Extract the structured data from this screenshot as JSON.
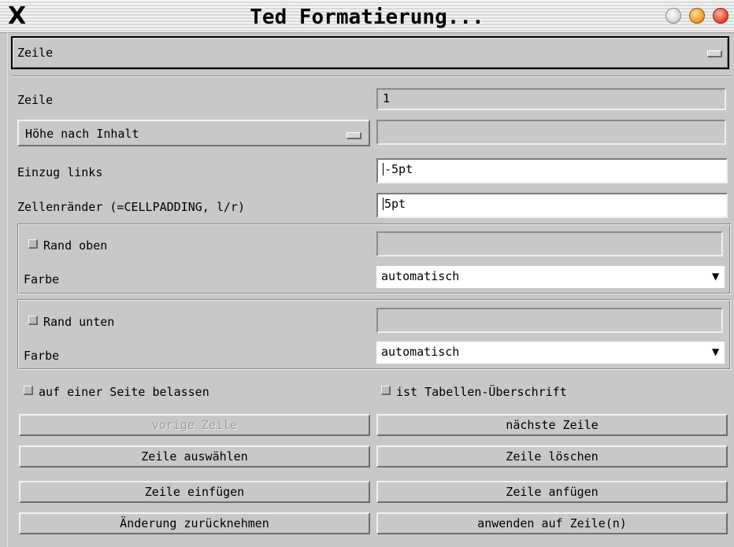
{
  "window": {
    "title": "Ted Formatierung...",
    "close_glyph": "X"
  },
  "section_selector": {
    "value": "Zeile"
  },
  "row": {
    "label": "Zeile",
    "value": "1"
  },
  "height": {
    "mode": "Höhe nach Inhalt",
    "value": ""
  },
  "indent_left": {
    "label": "Einzug links",
    "value": "-5pt"
  },
  "cell_padding": {
    "label": "Zellenränder (=CELLPADDING, l/r)",
    "value": "5pt"
  },
  "border_top": {
    "checkbox_label": "Rand oben",
    "checked": false,
    "width_value": "",
    "color_label": "Farbe",
    "color_value": "automatisch",
    "dropdown_glyph": "▼"
  },
  "border_bottom": {
    "checkbox_label": "Rand unten",
    "checked": false,
    "width_value": "",
    "color_label": "Farbe",
    "color_value": "automatisch",
    "dropdown_glyph": "▼"
  },
  "options": {
    "keep_on_page": {
      "label": "auf einer Seite belassen",
      "checked": false
    },
    "is_header": {
      "label": "ist Tabellen-Überschrift",
      "checked": false
    }
  },
  "buttons": {
    "previous_row": {
      "label": "vorige Zeile",
      "enabled": false
    },
    "next_row": {
      "label": "nächste Zeile",
      "enabled": true
    },
    "select_row": {
      "label": "Zeile auswählen",
      "enabled": true
    },
    "delete_row": {
      "label": "Zeile löschen",
      "enabled": true
    },
    "insert_row": {
      "label": "Zeile einfügen",
      "enabled": true
    },
    "append_row": {
      "label": "Zeile anfügen",
      "enabled": true
    },
    "revert": {
      "label": "Änderung zurücknehmen",
      "enabled": true
    },
    "apply": {
      "label": "anwenden auf Zeile(n)",
      "enabled": true
    }
  },
  "icons": {
    "close": "close-x-icon",
    "minimize": "minimize-circle-icon",
    "maximize": "maximize-circle-icon",
    "close_circle": "close-circle-icon",
    "checkbox": "checkbox-icon",
    "dropdown_indicator": "dropdown-indicator-icon",
    "dropdown_arrow": "chevron-down-icon"
  },
  "colors": {
    "background": "#c8c8c8",
    "field_white": "#ffffff",
    "maximize_button": "#f0a030",
    "close_button": "#e85030"
  }
}
